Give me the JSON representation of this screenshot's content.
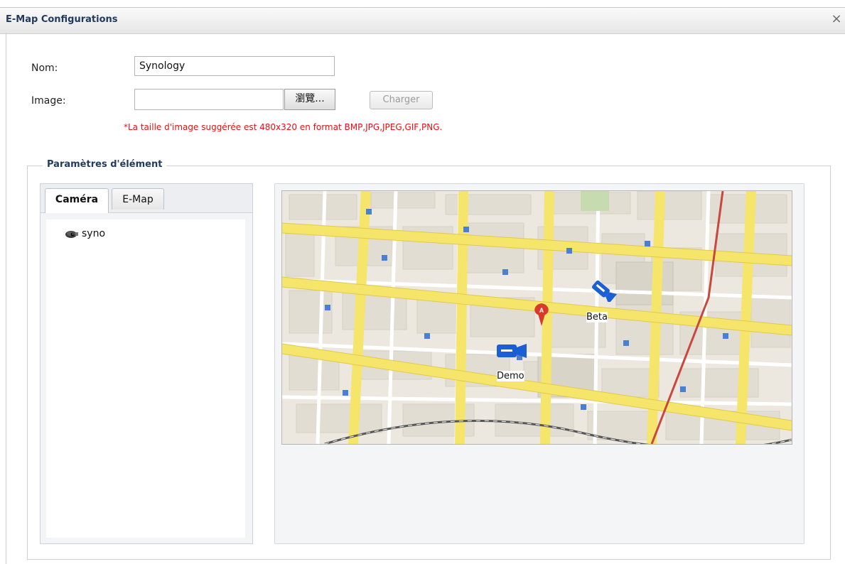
{
  "window": {
    "title": "E-Map Configurations",
    "close_glyph": "×"
  },
  "form": {
    "name_label": "Nom:",
    "name_value": "Synology",
    "image_label": "Image:",
    "image_value": "",
    "browse_label": "瀏覽...",
    "upload_label": "Charger",
    "note": "*La taille d'image suggérée est 480x320 en format BMP,JPG,JPEG,GIF,PNG."
  },
  "params": {
    "legend": "Paramètres d'élément",
    "tabs": [
      {
        "label": "Caméra",
        "active": true
      },
      {
        "label": "E-Map",
        "active": false
      }
    ],
    "tree": [
      {
        "label": "syno",
        "icon": "camera-icon"
      }
    ]
  },
  "map": {
    "cameras": [
      {
        "label": "Beta",
        "icon": "camera-marker-icon"
      },
      {
        "label": "Demo",
        "icon": "camera-marker-icon"
      }
    ],
    "pin_letter": "A",
    "colors": {
      "road": "#f5e56b",
      "block": "#e3ded3",
      "background": "#ece8df",
      "camera": "#1a5fd6",
      "pin": "#d8392b",
      "rail": "#c8483e"
    }
  }
}
